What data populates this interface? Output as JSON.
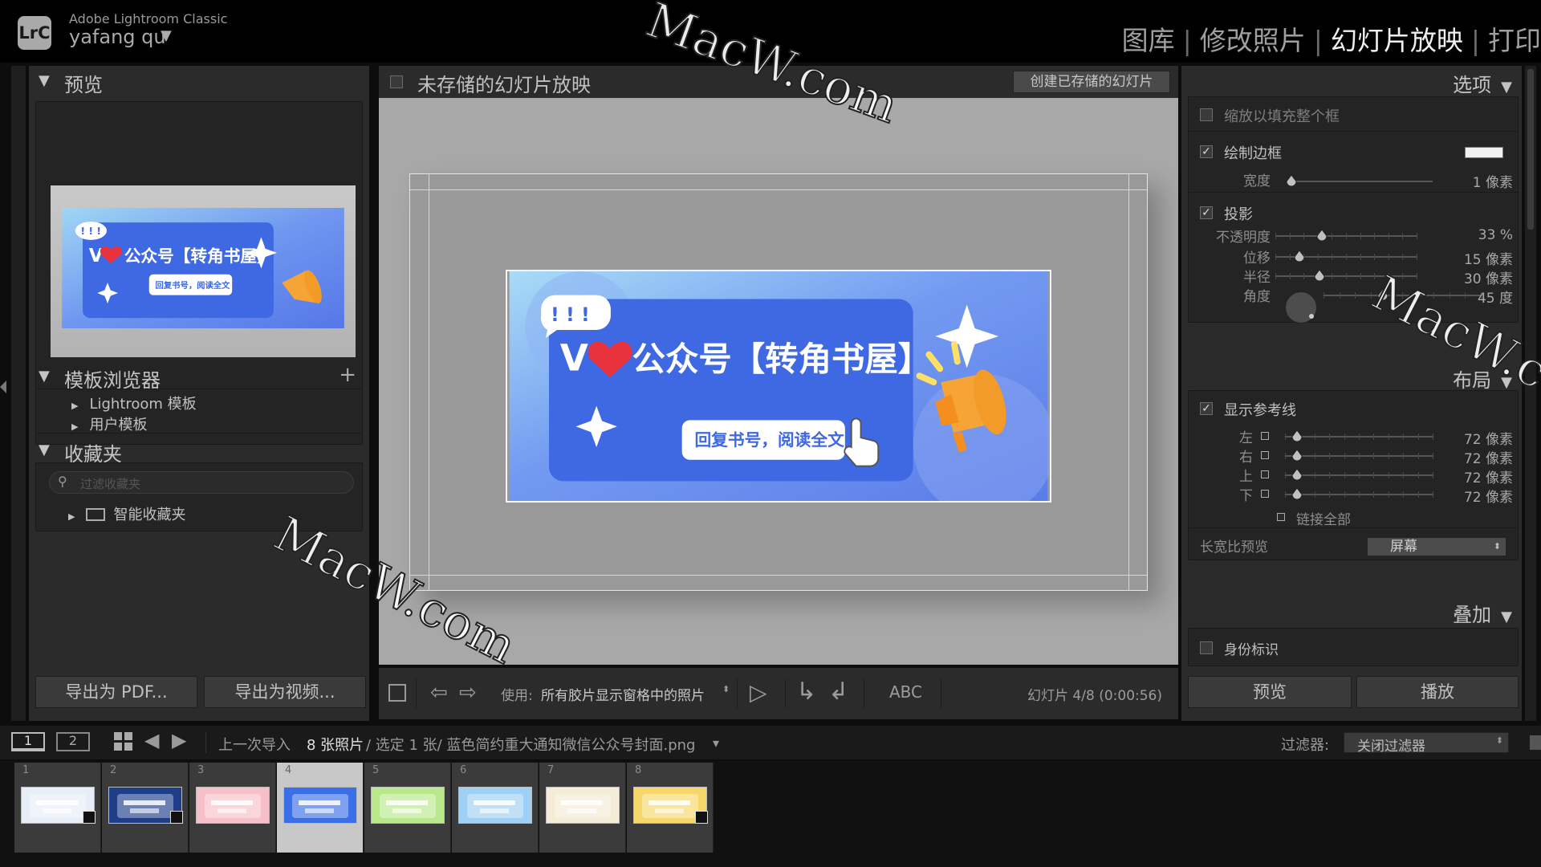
{
  "app": {
    "logo": "LrC",
    "name": "Adobe Lightroom Classic",
    "user": "yafang qu",
    "user_caret": "▼"
  },
  "modules": [
    {
      "label": "图库",
      "active": false
    },
    {
      "label": "修改照片",
      "active": false
    },
    {
      "label": "幻灯片放映",
      "active": true
    },
    {
      "label": "打印",
      "active": false
    }
  ],
  "left": {
    "preview_title": "预览",
    "template_title": "模板浏览器",
    "template_items": [
      "Lightroom 模板",
      "用户模板"
    ],
    "collections_title": "收藏夹",
    "search_placeholder": "过滤收藏夹",
    "smart_collection": "智能收藏夹",
    "export_pdf": "导出为 PDF...",
    "export_video": "导出为视频..."
  },
  "center": {
    "title": "未存储的幻灯片放映",
    "create_saved": "创建已存储的幻灯片",
    "toolbar": {
      "use_label": "使用:",
      "use_value": "所有胶片显示窗格中的照片",
      "abc": "ABC",
      "slide_status": "幻灯片 4/8 (0:00:56)"
    }
  },
  "slide_content": {
    "bubble": "! ! !",
    "heading_v": "V",
    "heading": "公众号【转角书屋】",
    "button_text": "回复书号，阅读全文"
  },
  "right": {
    "options_title": "选项",
    "zoom_fill": "缩放以填充整个框",
    "draw_border": "绘制边框",
    "width_label": "宽度",
    "width_value": "1 像素",
    "shadow": "投影",
    "shadow_rows": [
      {
        "label": "不透明度",
        "value": "33 %",
        "pos": 0.33
      },
      {
        "label": "位移",
        "value": "15 像素",
        "pos": 0.17
      },
      {
        "label": "半径",
        "value": "30 像素",
        "pos": 0.31
      },
      {
        "label": "角度",
        "value": "45 度",
        "pos": 0.38
      }
    ],
    "layout_title": "布局",
    "show_guides": "显示参考线",
    "guide_rows": [
      {
        "label": "左",
        "value": "72 像素",
        "pos": 0.08
      },
      {
        "label": "右",
        "value": "72 像素",
        "pos": 0.08
      },
      {
        "label": "上",
        "value": "72 像素",
        "pos": 0.08
      },
      {
        "label": "下",
        "value": "72 像素",
        "pos": 0.08
      }
    ],
    "link_all": "链接全部",
    "aspect_label": "长宽比预览",
    "aspect_value": "屏幕",
    "overlay_title": "叠加",
    "identity": "身份标识",
    "preview_btn": "预览",
    "play_btn": "播放"
  },
  "filmbar": {
    "view1": "1",
    "view2": "2",
    "source": "上一次导入",
    "count": "8 张照片",
    "selected": "/ 选定 1 张/ 蓝色简约重大通知微信公众号封面.png",
    "caret": "▾",
    "filter_label": "过滤器:",
    "filter_value": "关闭过滤器"
  },
  "filmstrip": [
    {
      "num": "1",
      "bg": "#e8eef8",
      "selected": false,
      "badge": true
    },
    {
      "num": "2",
      "bg": "#1e3e8a",
      "selected": false,
      "badge": true
    },
    {
      "num": "3",
      "bg": "#f7c0c8",
      "selected": false,
      "badge": false
    },
    {
      "num": "4",
      "bg": "#3b6fe8",
      "selected": true,
      "badge": false
    },
    {
      "num": "5",
      "bg": "#b9e88a",
      "selected": false,
      "badge": false
    },
    {
      "num": "6",
      "bg": "#9ed0f5",
      "selected": false,
      "badge": false
    },
    {
      "num": "7",
      "bg": "#f5ecd8",
      "selected": false,
      "badge": false
    },
    {
      "num": "8",
      "bg": "#f8d76a",
      "selected": false,
      "badge": true
    }
  ],
  "watermark": "MacW.com",
  "colors": {
    "panel": "#2b2b2b",
    "stage": "#a8a8a8",
    "accent_blue": "#3b6fe8",
    "heart": "#e8323c"
  }
}
